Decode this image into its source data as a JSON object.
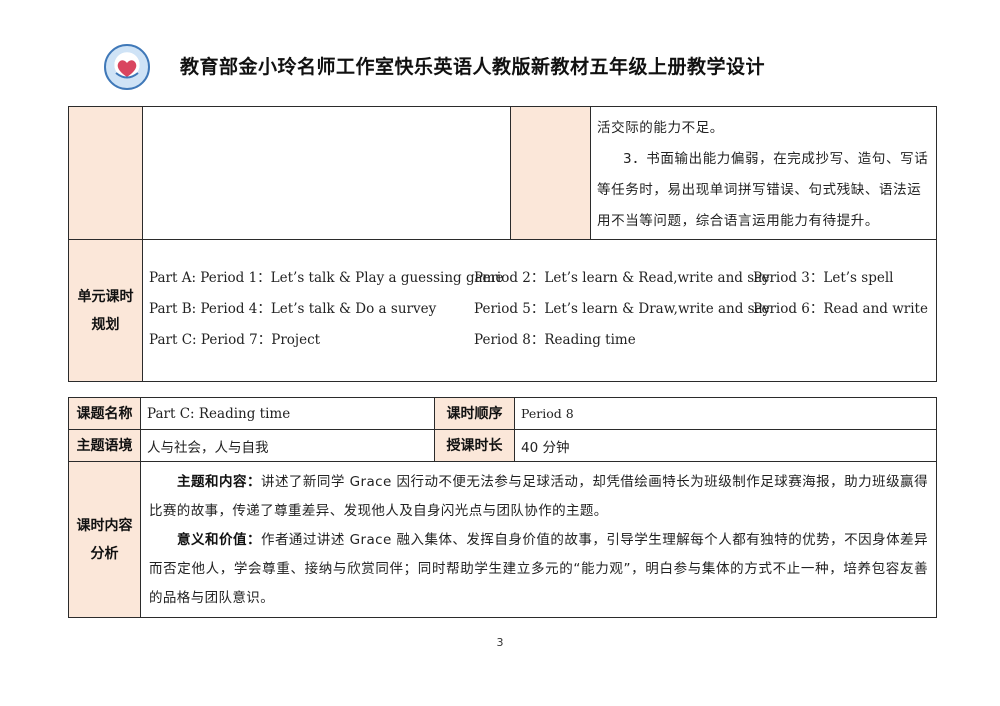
{
  "header": {
    "title": "教育部金小玲名师工作室快乐英语人教版新教材五年级上册教学设计"
  },
  "continuation": {
    "lines": [
      "活交际的能力不足。",
      "3．书面输出能力偏弱，在完成抄写、造句、写话",
      "等任务时，易出现单词拼写错误、句式残缺、语法运",
      "用不当等问题，综合语言运用能力有待提升。"
    ]
  },
  "unit_plan": {
    "header": [
      "单元课时",
      "规划"
    ],
    "rows": [
      [
        "Part A: Period 1：Let’s talk & Play a guessing game",
        "Period 2：Let’s learn & Read,write and say",
        "Period 3：Let’s spell"
      ],
      [
        "Part B: Period 4：Let’s talk & Do a survey",
        "Period 5：Let’s learn & Draw,write and say",
        "Period 6：Read and write"
      ],
      [
        "Part C: Period 7：Project",
        "Period 8：Reading time",
        ""
      ]
    ]
  },
  "lesson": {
    "topic_label": "课题名称",
    "topic_value": "Part C: Reading time",
    "order_label": "课时顺序",
    "order_value": "Period 8",
    "context_label": "主题语境",
    "context_value": "人与社会，人与自我",
    "duration_label": "授课时长",
    "duration_value": "40 分钟",
    "analysis_header": [
      "课时内容",
      "分析"
    ],
    "analysis": [
      {
        "lead": "主题和内容：",
        "text": "讲述了新同学 Grace 因行动不便无法参与足球活动，却凭借绘画特长为班级制作足球赛海报，助力班级赢得比赛的故事，传递了尊重差异、发现他人及自身闪光点与团队协作的主题。"
      },
      {
        "lead": "意义和价值：",
        "text": "作者通过讲述 Grace 融入集体、发挥自身价值的故事，引导学生理解每个人都有独特的优势，不因身体差异而否定他人，学会尊重、接纳与欣赏同伴；同时帮助学生建立多元的“能力观”，明白参与集体的方式不止一种，培养包容友善的品格与团队意识。"
      }
    ]
  },
  "footer": {
    "page_number": "3"
  },
  "colors": {
    "header_fill": "#fbe7d9",
    "border": "#2b2b2b",
    "logo_blue": "#3f78b8"
  }
}
